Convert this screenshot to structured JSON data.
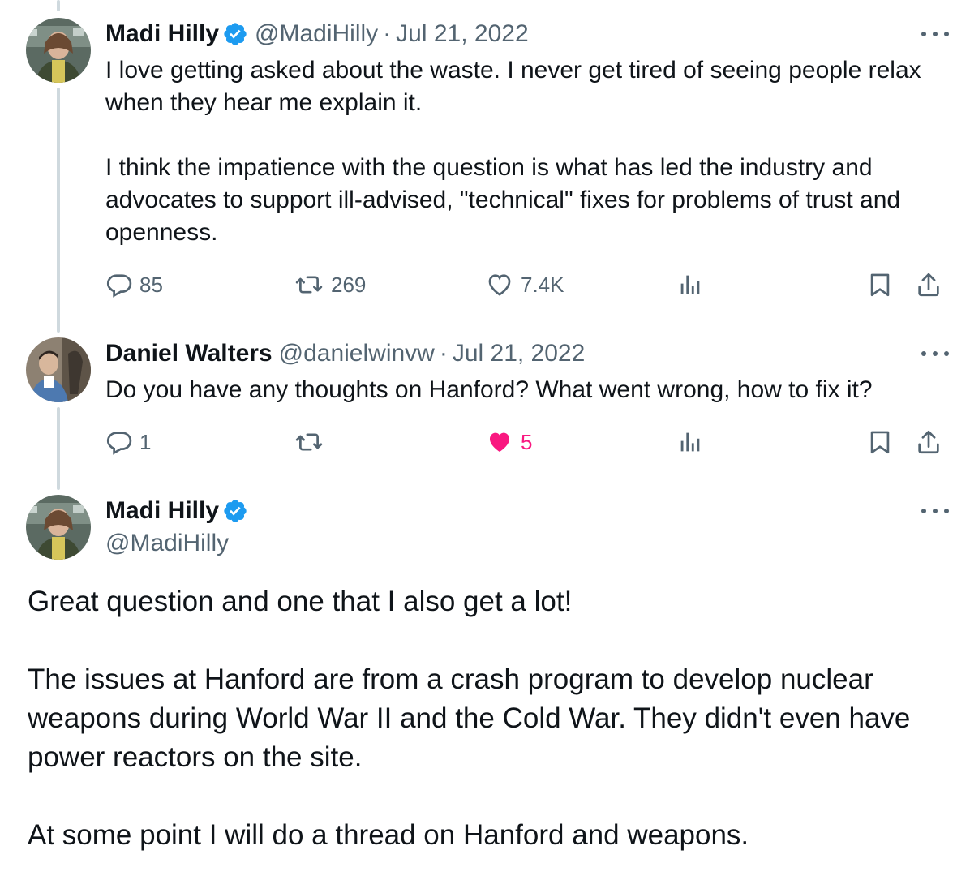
{
  "tweets": [
    {
      "name": "Madi Hilly",
      "handle": "@MadiHilly",
      "date": "Jul 21, 2022",
      "text": "I love getting asked about the waste. I never get tired of seeing people relax when they hear me explain it.\n\nI think the impatience with the question is what has led the industry and advocates to support ill-advised, \"technical\" fixes for problems of trust and openness.",
      "replies": "85",
      "reposts": "269",
      "likes": "7.4K",
      "verified": true
    },
    {
      "name": "Daniel Walters",
      "handle": "@danielwinvw",
      "date": "Jul 21, 2022",
      "text": "Do you have any thoughts on Hanford? What went wrong, how to fix it?",
      "replies": "1",
      "reposts": "",
      "likes": "5",
      "liked": true,
      "verified": false
    }
  ],
  "main_tweet": {
    "name": "Madi Hilly",
    "handle": "@MadiHilly",
    "text": "Great question and one that I also get a lot!\n\nThe issues at Hanford are from a crash program to develop nuclear weapons during World War II and the Cold War. They didn't even have power reactors on the site.\n\nAt some point I will do a thread on Hanford and weapons.",
    "verified": true
  },
  "icons": {
    "reply": "reply-icon",
    "repost": "repost-icon",
    "like": "heart-icon",
    "views": "views-icon",
    "bookmark": "bookmark-icon",
    "share": "share-icon",
    "more": "more-icon",
    "verified": "verified-badge-icon"
  },
  "colors": {
    "text": "#0f1419",
    "secondary": "#536471",
    "verified": "#1d9bf0",
    "like_active": "#f91880",
    "thread_line": "#cfd9de"
  }
}
